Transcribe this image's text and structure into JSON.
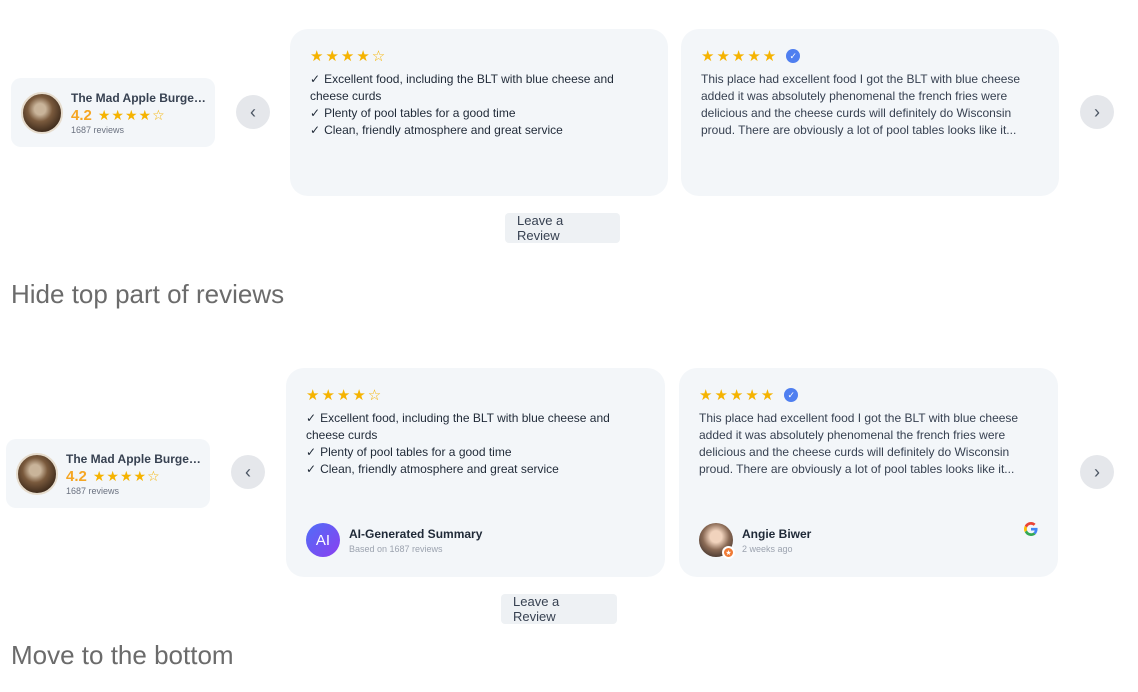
{
  "business": {
    "name": "The Mad Apple Burger ...",
    "rating": "4.2",
    "stars": "★★★★☆",
    "count": "1687 reviews"
  },
  "nav": {
    "prev_icon": "‹",
    "next_icon": "›"
  },
  "cards": {
    "summary": {
      "stars": "★★★★☆",
      "bullets": [
        "Excellent food, including the BLT with blue cheese and cheese curds",
        "Plenty of pool tables for a good time",
        "Clean, friendly atmosphere and great service"
      ],
      "author": "AI-Generated Summary",
      "sub": "Based on 1687 reviews",
      "avatar_text": "AI"
    },
    "review": {
      "stars": "★★★★★",
      "verified_icon": "✓",
      "text": "This place had excellent food I got the BLT with blue cheese added it was absolutely phenomenal the french fries were delicious and the cheese curds will definitely do Wisconsin proud. There are obviously a lot of pool tables looks like it...",
      "author": "Angie Biwer",
      "sub": "2 weeks ago"
    }
  },
  "leave_review": "Leave a Review",
  "captions": {
    "first": "Hide top part of reviews",
    "second": "Move to the bottom"
  },
  "colors": {
    "star": "#f5b301",
    "accent": "#4f7ff0",
    "card_bg": "#f3f6f9"
  }
}
